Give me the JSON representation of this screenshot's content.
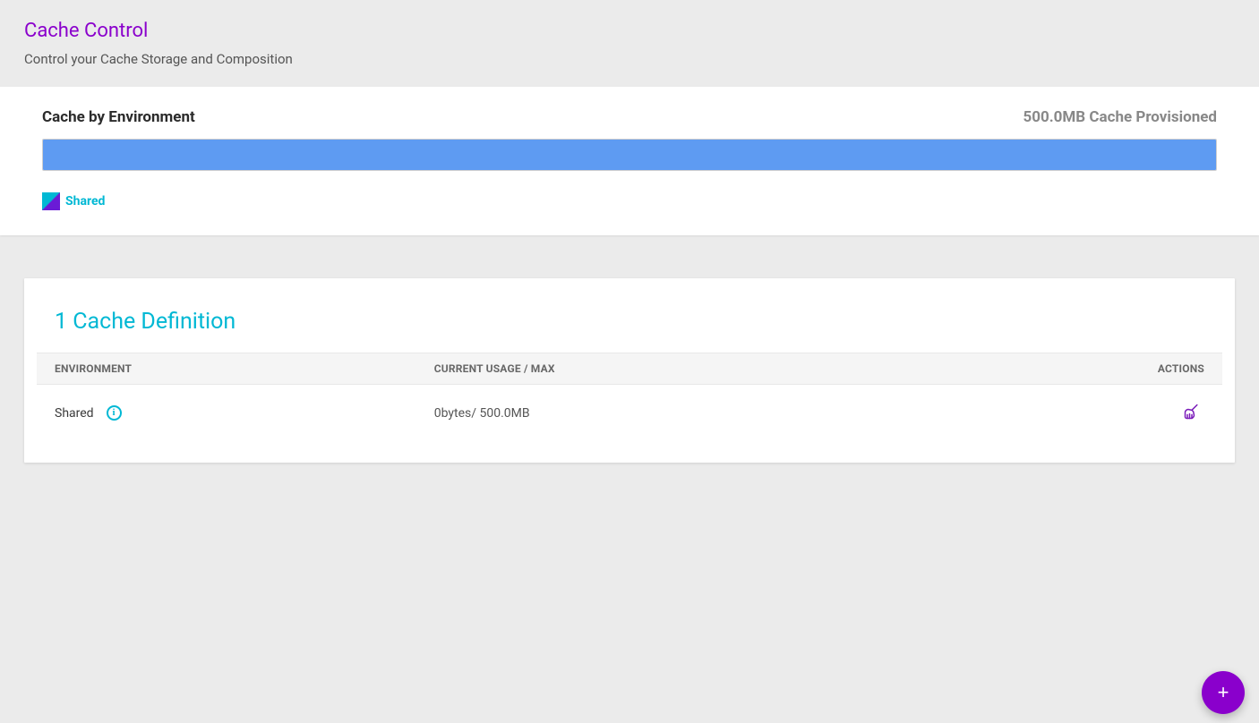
{
  "header": {
    "title": "Cache Control",
    "subtitle": "Control your Cache Storage and Composition"
  },
  "overview": {
    "title": "Cache by Environment",
    "provisioned_text": "500.0MB Cache Provisioned",
    "legend": [
      {
        "label": "Shared"
      }
    ]
  },
  "definitions": {
    "title": "1 Cache Definition",
    "columns": {
      "environment": "ENVIRONMENT",
      "usage": "CURRENT USAGE / MAX",
      "actions": "ACTIONS"
    },
    "rows": [
      {
        "environment": "Shared",
        "usage": "0bytes/ 500.0MB"
      }
    ]
  },
  "fab": {
    "label": "+"
  },
  "colors": {
    "accent_purple": "#8a00cc",
    "accent_cyan": "#00b8d4",
    "bar_blue": "#5e9bf2"
  }
}
